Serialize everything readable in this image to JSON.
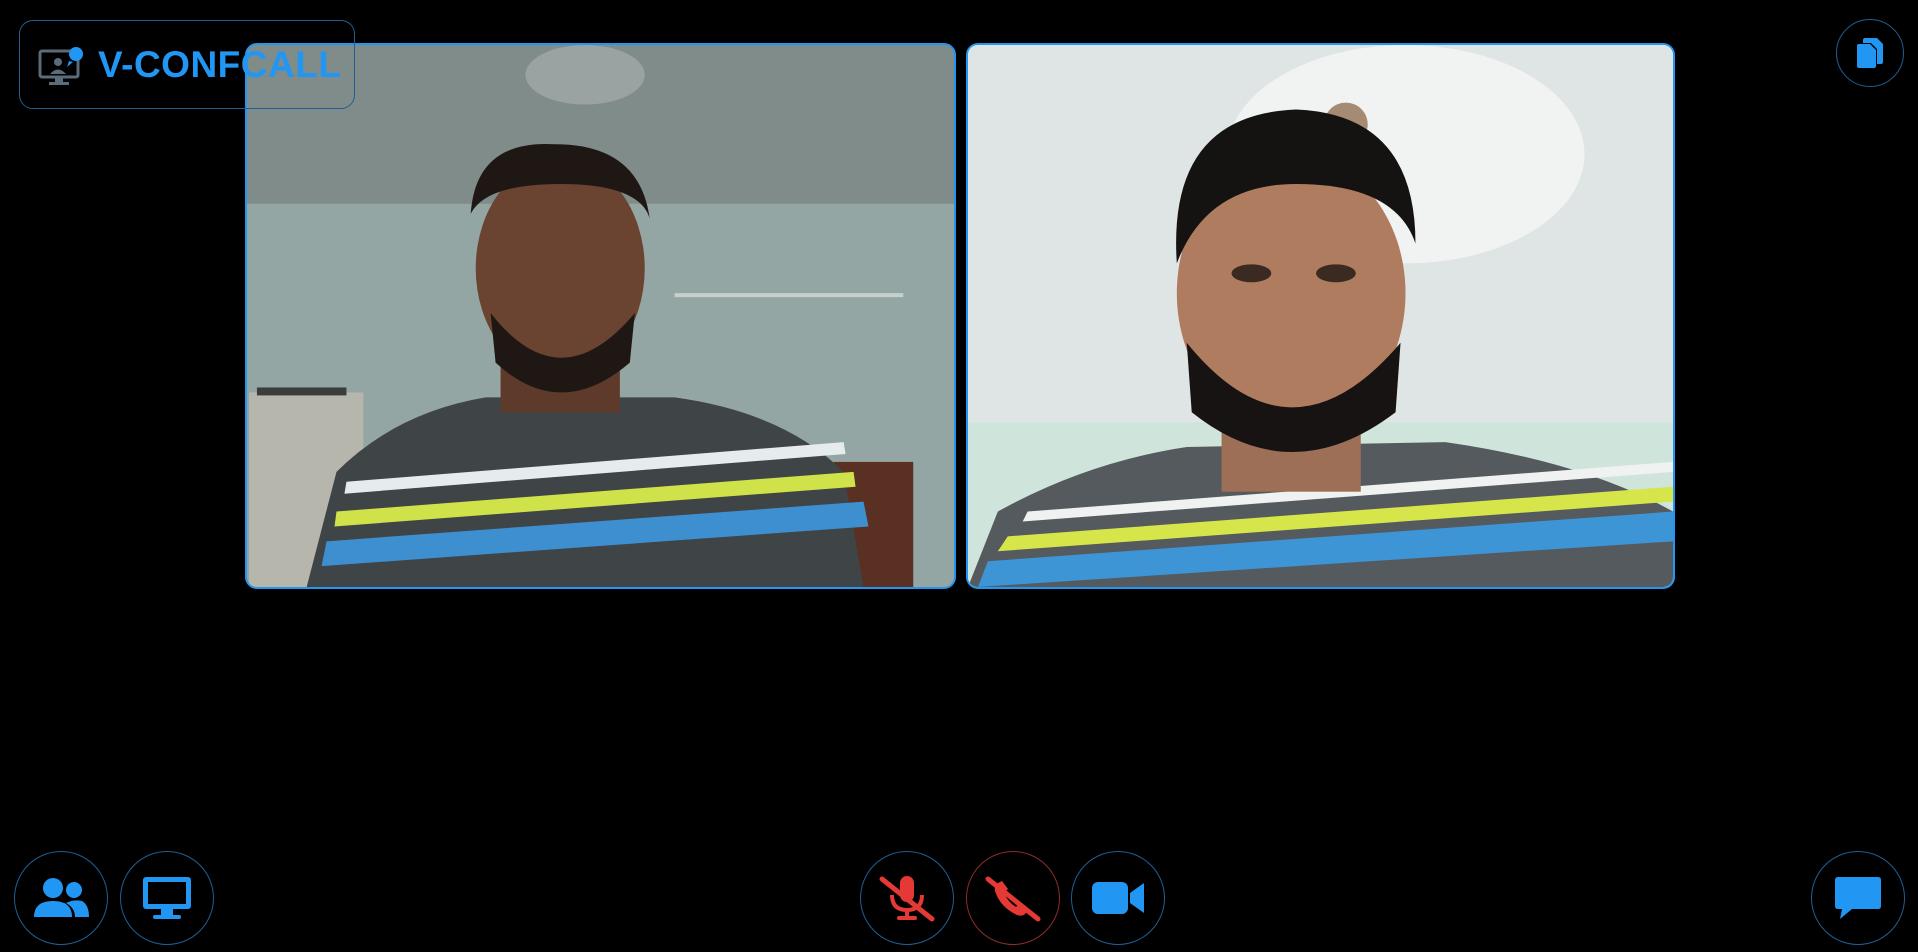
{
  "app": {
    "name": "V-CONFCALL",
    "logo_icon": "presenter-monitor-icon"
  },
  "participants": [
    {
      "id": "local",
      "kind": "video-feed"
    },
    {
      "id": "remote",
      "kind": "video-feed"
    }
  ],
  "toolbar": {
    "top_right": {
      "icon": "copy-icon"
    },
    "left": [
      {
        "icon": "participants-icon"
      },
      {
        "icon": "screen-share-icon"
      }
    ],
    "center": [
      {
        "icon": "mic-muted-icon",
        "state": "muted",
        "color": "#e53935"
      },
      {
        "icon": "hang-up-icon",
        "state": "end-call",
        "color": "#e53935"
      },
      {
        "icon": "video-camera-icon",
        "state": "on",
        "color": "#2196f3"
      }
    ],
    "right": [
      {
        "icon": "chat-icon"
      }
    ]
  },
  "colors": {
    "accent": "#2196f3",
    "danger": "#e53935",
    "background": "#000000"
  }
}
